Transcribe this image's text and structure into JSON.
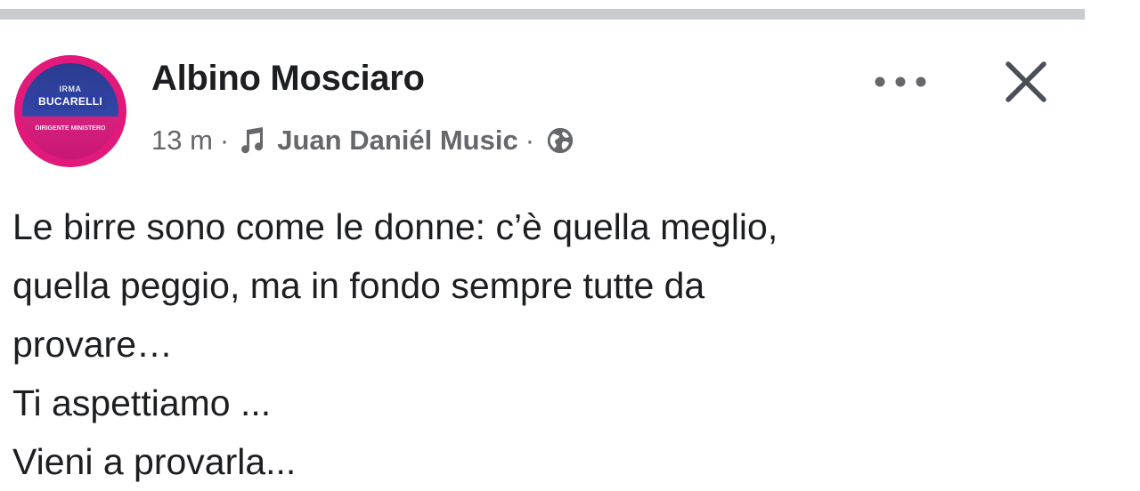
{
  "post": {
    "avatar": {
      "small_text": "IRMA",
      "name_text": "BUCARELLI",
      "sub_text": "DIRIGENTE MINISTERO"
    },
    "author": "Albino Mosciaro",
    "time": "13 m",
    "separator": "·",
    "music_label": "Juan Daniél Music",
    "privacy_icon": "globe-icon",
    "music_icon": "music-note-icon",
    "more_icon": "more-options-icon",
    "close_icon": "close-icon",
    "body_lines": [
      "Le birre sono come le donne: c’è quella meglio,",
      "quella peggio, ma in fondo sempre tutte da",
      "provare…",
      "Ti aspettiamo ...",
      "Vieni a provarla..."
    ]
  },
  "colors": {
    "divider": "#c9ccd1",
    "text_primary": "#1c1e21",
    "text_secondary": "#65676b",
    "avatar_ring": "#e0197a"
  }
}
